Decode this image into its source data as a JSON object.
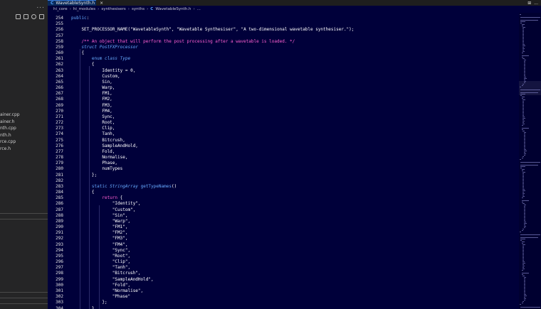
{
  "sidebar": {
    "more_label": "...",
    "files": [
      {
        "label": "ainer.cpp"
      },
      {
        "label": "ainer.h"
      },
      {
        "label": "nth.cpp"
      },
      {
        "label": "nth.h"
      },
      {
        "label": "rce.cpp"
      },
      {
        "label": "rce.h"
      }
    ]
  },
  "tab": {
    "icon": "C",
    "label": "WavetableSynth.h",
    "close": "×"
  },
  "tab_actions": {
    "split": "⊞",
    "more": "..."
  },
  "breadcrumb": {
    "items": [
      "hi_core",
      "hi_modules",
      "synthesisers",
      "synths"
    ],
    "file_icon": "C",
    "file": "WavetableSynth.h",
    "ellipsis": "..."
  },
  "editor": {
    "lines": [
      {
        "n": "254",
        "text": "public:"
      },
      {
        "n": "255",
        "text": ""
      },
      {
        "n": "256",
        "text": "    SET_PROCESSOR_NAME(\"WavetableSynth\", \"Wavetable Synthesiser\", \"A two-dimensional wavetable synthesiser.\");"
      },
      {
        "n": "257",
        "text": ""
      },
      {
        "n": "258",
        "text": "    /** An object that will perform the post processing after a wavetable is loaded. */"
      },
      {
        "n": "259",
        "text": "    struct PostFXProcessor"
      },
      {
        "n": "260",
        "text": "    {"
      },
      {
        "n": "261",
        "text": "        enum class Type"
      },
      {
        "n": "262",
        "text": "        {"
      },
      {
        "n": "263",
        "text": "            Identity = 0,"
      },
      {
        "n": "264",
        "text": "            Custom,"
      },
      {
        "n": "265",
        "text": "            Sin,"
      },
      {
        "n": "266",
        "text": "            Warp,"
      },
      {
        "n": "267",
        "text": "            FM1,"
      },
      {
        "n": "268",
        "text": "            FM2,"
      },
      {
        "n": "269",
        "text": "            FM3,"
      },
      {
        "n": "270",
        "text": "            FM4,"
      },
      {
        "n": "271",
        "text": "            Sync,"
      },
      {
        "n": "272",
        "text": "            Root,"
      },
      {
        "n": "273",
        "text": "            Clip,"
      },
      {
        "n": "274",
        "text": "            Tanh,"
      },
      {
        "n": "275",
        "text": "            Bitcrush,"
      },
      {
        "n": "276",
        "text": "            SampleAndHold,"
      },
      {
        "n": "277",
        "text": "            Fold,"
      },
      {
        "n": "278",
        "text": "            Normalise,"
      },
      {
        "n": "279",
        "text": "            Phase,"
      },
      {
        "n": "280",
        "text": "            numTypes"
      },
      {
        "n": "281",
        "text": "        };"
      },
      {
        "n": "282",
        "text": ""
      },
      {
        "n": "283",
        "text": "        static StringArray getTypeNames()"
      },
      {
        "n": "284",
        "text": "        {"
      },
      {
        "n": "285",
        "text": "            return {"
      },
      {
        "n": "286",
        "text": "                \"Identity\","
      },
      {
        "n": "287",
        "text": "                \"Custom\","
      },
      {
        "n": "288",
        "text": "                \"Sin\","
      },
      {
        "n": "289",
        "text": "                \"Warp\","
      },
      {
        "n": "290",
        "text": "                \"FM1\","
      },
      {
        "n": "291",
        "text": "                \"FM2\","
      },
      {
        "n": "292",
        "text": "                \"FM3\","
      },
      {
        "n": "293",
        "text": "                \"FM4\","
      },
      {
        "n": "294",
        "text": "                \"Sync\","
      },
      {
        "n": "295",
        "text": "                \"Root\","
      },
      {
        "n": "296",
        "text": "                \"Clip\","
      },
      {
        "n": "297",
        "text": "                \"Tanh\","
      },
      {
        "n": "298",
        "text": "                \"Bitcrush\","
      },
      {
        "n": "299",
        "text": "                \"SampleAndHold\","
      },
      {
        "n": "300",
        "text": "                \"Fold\","
      },
      {
        "n": "301",
        "text": "                \"Normalise\","
      },
      {
        "n": "302",
        "text": "                \"Phase\""
      },
      {
        "n": "303",
        "text": "            };"
      },
      {
        "n": "304",
        "text": "        }"
      }
    ]
  }
}
